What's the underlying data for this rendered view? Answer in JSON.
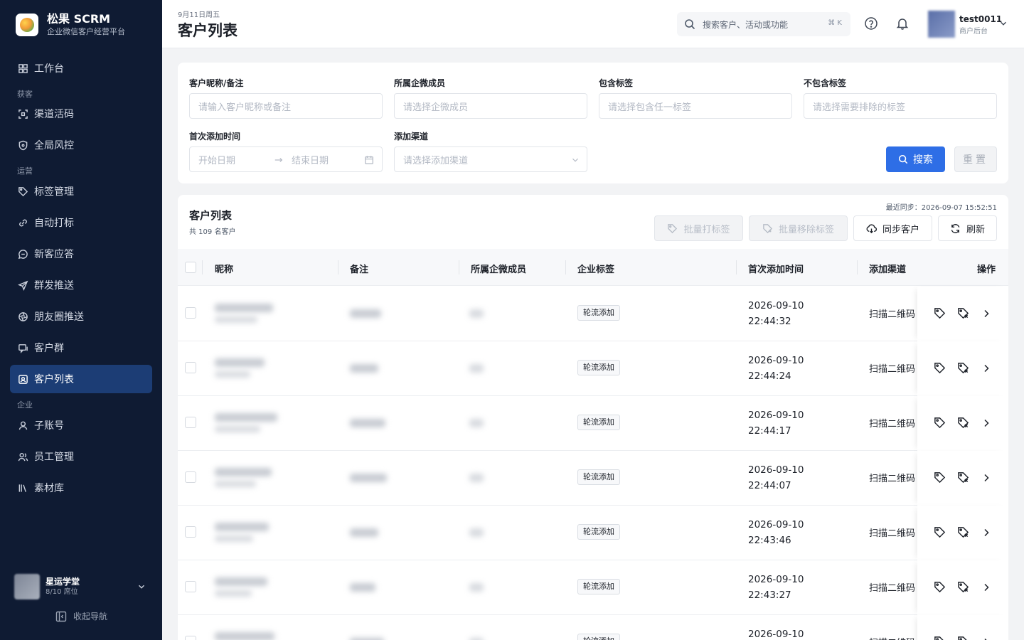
{
  "brand": {
    "name": "松果 SCRM",
    "subtitle": "企业微信客户经营平台"
  },
  "sidebar": {
    "items": [
      {
        "label": "工作台",
        "icon": "grid-icon"
      },
      {
        "group": "获客"
      },
      {
        "label": "渠道活码",
        "icon": "qr-scan-icon"
      },
      {
        "label": "全局风控",
        "icon": "shield-icon"
      },
      {
        "group": "运营"
      },
      {
        "label": "标签管理",
        "icon": "tag-icon"
      },
      {
        "label": "自动打标",
        "icon": "link-icon"
      },
      {
        "label": "新客应答",
        "icon": "chat-icon"
      },
      {
        "label": "群发推送",
        "icon": "send-icon"
      },
      {
        "label": "朋友圈推送",
        "icon": "aperture-icon"
      },
      {
        "label": "客户群",
        "icon": "group-chat-icon"
      },
      {
        "label": "客户列表",
        "icon": "contact-icon",
        "active": true
      },
      {
        "group": "企业"
      },
      {
        "label": "子账号",
        "icon": "user-icon"
      },
      {
        "label": "员工管理",
        "icon": "users-icon"
      },
      {
        "label": "素材库",
        "icon": "library-icon"
      }
    ],
    "org": {
      "name": "星运学堂",
      "seats": "8/10 席位"
    },
    "collapse_label": "收起导航"
  },
  "header": {
    "date": "9月11日周五",
    "title": "客户列表",
    "search_placeholder": "搜索客户、活动或功能",
    "search_shortcut": "⌘ K",
    "user_name": "test0011",
    "user_role": "商户后台"
  },
  "filters": {
    "nickname": {
      "label": "客户昵称/备注",
      "placeholder": "请输入客户昵称或备注"
    },
    "member": {
      "label": "所属企微成员",
      "placeholder": "请选择企微成员"
    },
    "include_tags": {
      "label": "包含标签",
      "placeholder": "请选择包含任一标签"
    },
    "exclude_tags": {
      "label": "不包含标签",
      "placeholder": "请选择需要排除的标签"
    },
    "first_add_time": {
      "label": "首次添加时间",
      "start_placeholder": "开始日期",
      "end_placeholder": "结束日期"
    },
    "channel": {
      "label": "添加渠道",
      "placeholder": "请选择添加渠道"
    },
    "search_label": "搜索",
    "reset_label": "重置"
  },
  "list": {
    "title": "客户列表",
    "count": "共 109 名客户",
    "last_sync": "最近同步：2026-09-07 15:52:51",
    "actions": {
      "batch_tag": "批量打标签",
      "batch_untag": "批量移除标签",
      "sync": "同步客户",
      "refresh": "刷新"
    },
    "columns": [
      "昵称",
      "备注",
      "所属企微成员",
      "企业标签",
      "首次添加时间",
      "添加渠道",
      "操作"
    ],
    "rows": [
      {
        "tag": "轮流添加",
        "date": "2026-09-10",
        "time": "22:44:32",
        "channel": "扫描二维码"
      },
      {
        "tag": "轮流添加",
        "date": "2026-09-10",
        "time": "22:44:24",
        "channel": "扫描二维码"
      },
      {
        "tag": "轮流添加",
        "date": "2026-09-10",
        "time": "22:44:17",
        "channel": "扫描二维码"
      },
      {
        "tag": "轮流添加",
        "date": "2026-09-10",
        "time": "22:44:07",
        "channel": "扫描二维码"
      },
      {
        "tag": "轮流添加",
        "date": "2026-09-10",
        "time": "22:43:46",
        "channel": "扫描二维码"
      },
      {
        "tag": "轮流添加",
        "date": "2026-09-10",
        "time": "22:43:27",
        "channel": "扫描二维码"
      },
      {
        "tag": "轮流添加",
        "date": "2026-09-10",
        "time": "",
        "channel": "扫描二维码"
      }
    ]
  },
  "colors": {
    "sidebar_bg": "#0f1b33",
    "active_nav": "#1c3d75",
    "primary": "#2e6ee6"
  }
}
